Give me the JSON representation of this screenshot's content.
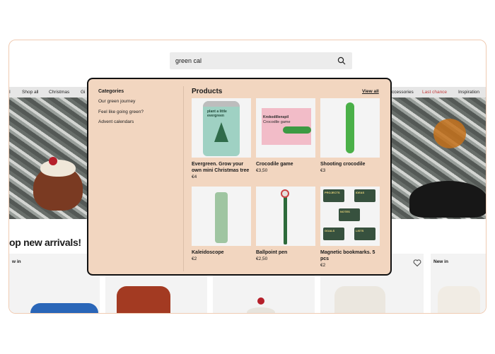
{
  "search": {
    "value": "green cal"
  },
  "nav": [
    {
      "label": "Shop all"
    },
    {
      "label": "Christmas"
    },
    {
      "label": "Gi"
    },
    {
      "label": "ccessories"
    },
    {
      "label": "Last chance"
    },
    {
      "label": "Inspiration"
    }
  ],
  "section": {
    "title": "op new arrivals!"
  },
  "cards": [
    {
      "badge": "w in"
    },
    {
      "badge": "New in"
    }
  ],
  "dropdown": {
    "categories_title": "Categories",
    "categories": [
      {
        "label": "Our green journey"
      },
      {
        "label": "Feel like going green?"
      },
      {
        "label": "Advent calendars"
      }
    ],
    "products_title": "Products",
    "view_all": "View all",
    "products": [
      {
        "name": "Evergreen. Grow your own mini Christmas tree",
        "price": "€4"
      },
      {
        "name": "Crocodile game",
        "price": "€3,50"
      },
      {
        "name": "Shooting crocodile",
        "price": "€3"
      },
      {
        "name": "Kaleidoscope",
        "price": "€2"
      },
      {
        "name": "Ballpoint pen",
        "price": "€2,50"
      },
      {
        "name": "Magnetic bookmarks. 5 pcs",
        "price": "€2"
      }
    ],
    "box_text": {
      "tin": "plant a little evergreen",
      "croc_title": "Krokodillenspil",
      "croc_sub": "Crocodile game",
      "bookmarks": [
        "PROJECTS",
        "IDEAS",
        "NOTES",
        "GOALS",
        "LISTS"
      ]
    }
  },
  "colors": {
    "dropdown_bg": "#f2d6c0",
    "accent_red": "#c23b3b",
    "frame_border": "#f0cbb2"
  }
}
